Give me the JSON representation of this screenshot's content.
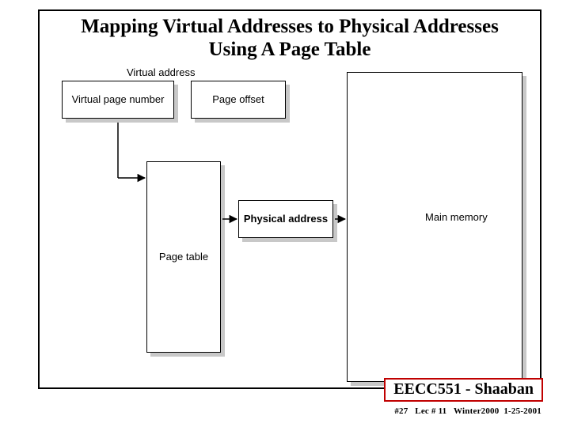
{
  "title": "Mapping Virtual Addresses to Physical Addresses Using A Page Table",
  "labels": {
    "virtual_address": "Virtual address",
    "virtual_page_number": "Virtual page number",
    "page_offset": "Page offset",
    "page_table": "Page table",
    "physical_address": "Physical address",
    "main_memory": "Main memory"
  },
  "course": "EECC551 - Shaaban",
  "footer": {
    "slide_no": "#27",
    "lecture": "Lec # 11",
    "term": "Winter2000",
    "date": "1-25-2001"
  }
}
